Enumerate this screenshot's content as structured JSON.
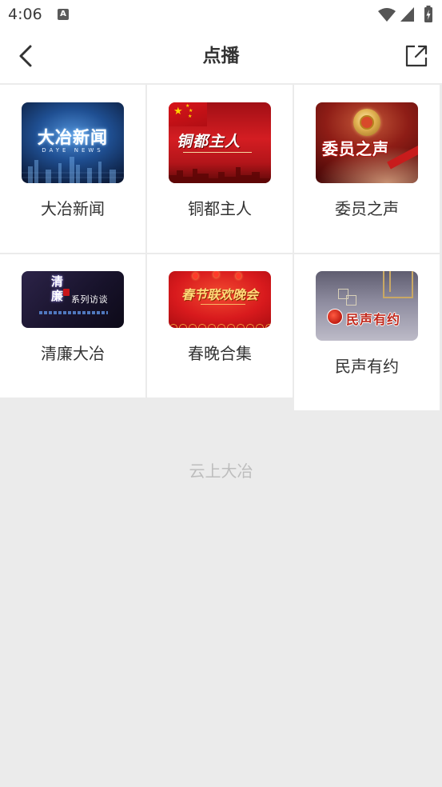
{
  "status_bar": {
    "time": "4:06",
    "notification_letter": "A",
    "notification_icon": "a-letter-notification-icon",
    "wifi_icon": "wifi-icon",
    "signal_icon": "cell-signal-icon",
    "battery_icon": "battery-charging-icon"
  },
  "header": {
    "title": "点播",
    "back_icon": "back-chevron-icon",
    "share_icon": "share-external-icon"
  },
  "programs": [
    {
      "label": "大冶新闻",
      "thumb_title": "大冶新闻",
      "thumb_subtitle": "DAYE NEWS"
    },
    {
      "label": "铜都主人",
      "thumb_title": "铜都主人"
    },
    {
      "label": "委员之声",
      "thumb_title": "委员之声"
    },
    {
      "label": "清廉大冶",
      "thumb_title": "清廉",
      "thumb_subtitle": "系列访谈"
    },
    {
      "label": "春晚合集",
      "thumb_title": "春节联欢晚会"
    },
    {
      "label": "民声有约",
      "thumb_title": "民声有约"
    }
  ],
  "footer": {
    "text": "云上大冶"
  },
  "colors": {
    "page_background": "#ebebeb",
    "surface": "#ffffff",
    "text_primary": "#333333",
    "footer_text": "#bdbdbd"
  }
}
